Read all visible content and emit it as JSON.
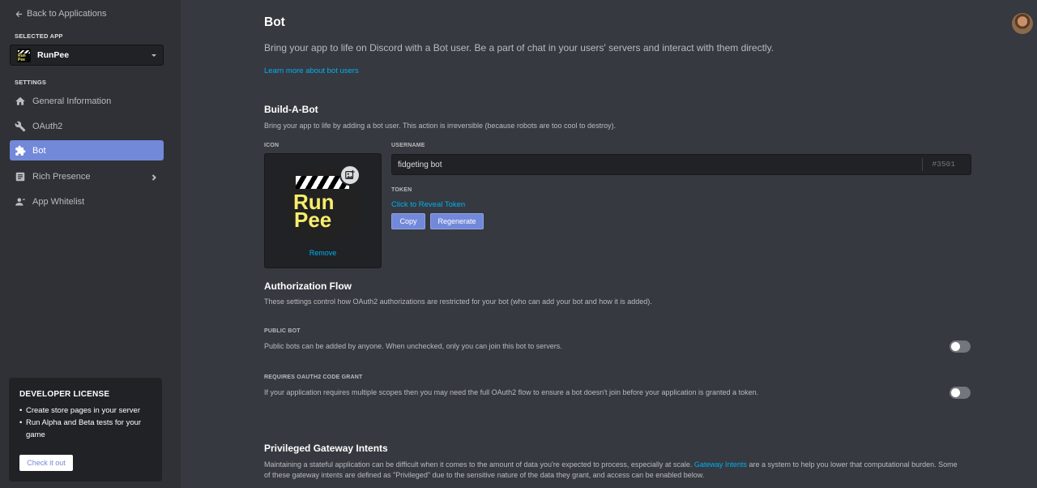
{
  "sidebar": {
    "back_label": "Back to Applications",
    "selected_app_label": "SELECTED APP",
    "app_name": "RunPee",
    "settings_label": "SETTINGS",
    "items": [
      {
        "label": "General Information",
        "icon": "home-icon"
      },
      {
        "label": "OAuth2",
        "icon": "wrench-icon"
      },
      {
        "label": "Bot",
        "icon": "puzzle-icon",
        "active": true
      },
      {
        "label": "Rich Presence",
        "icon": "document-icon"
      },
      {
        "label": "App Whitelist",
        "icon": "person-icon"
      }
    ],
    "license": {
      "title": "DEVELOPER LICENSE",
      "points": [
        "Create store pages in your server",
        "Run Alpha and Beta tests for your game"
      ],
      "button": "Check it out"
    }
  },
  "main": {
    "title": "Bot",
    "intro": "Bring your app to life on Discord with a Bot user. Be a part of chat in your users' servers and interact with them directly.",
    "learn_more": "Learn more about bot users",
    "build": {
      "title": "Build-A-Bot",
      "desc": "Bring your app to life by adding a bot user. This action is irreversible (because robots are too cool to destroy).",
      "icon_label": "ICON",
      "remove": "Remove",
      "username_label": "USERNAME",
      "username": "fidgeting bot",
      "discriminator": "#3501",
      "token_label": "TOKEN",
      "reveal": "Click to Reveal Token",
      "copy": "Copy",
      "regenerate": "Regenerate"
    },
    "auth": {
      "title": "Authorization Flow",
      "desc": "These settings control how OAuth2 authorizations are restricted for your bot (who can add your bot and how it is added).",
      "public_label": "PUBLIC BOT",
      "public_desc": "Public bots can be added by anyone. When unchecked, only you can join this bot to servers.",
      "public_on": false,
      "grant_label": "REQUIRES OAUTH2 CODE GRANT",
      "grant_desc": "If your application requires multiple scopes then you may need the full OAuth2 flow to ensure a bot doesn't join before your application is granted a token.",
      "grant_on": false
    },
    "gateway": {
      "title": "Privileged Gateway Intents",
      "desc_a": "Maintaining a stateful application can be difficult when it comes to the amount of data you're expected to process, especially at scale.",
      "desc_link": "Gateway Intents",
      "desc_b": "are a system to help you lower that computational",
      "desc_c": "burden. Some of these gateway intents are defined as \"Privileged\" due to the sensitive nature of the data they grant, and access can be enabled below."
    }
  },
  "app_icon_text": "RunPee",
  "colors": {
    "accent": "#7289da",
    "link": "#00b0f4",
    "bg": "#36393f",
    "sidebar": "#2f3136"
  }
}
